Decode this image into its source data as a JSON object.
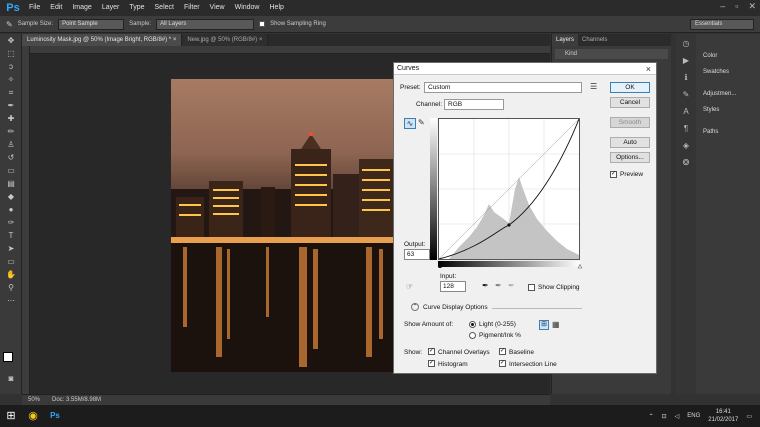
{
  "app": {
    "logo": "Ps"
  },
  "menu": [
    "File",
    "Edit",
    "Image",
    "Layer",
    "Type",
    "Select",
    "Filter",
    "View",
    "Window",
    "Help"
  ],
  "options": {
    "sample_size_label": "Sample Size:",
    "sample_size_value": "Point Sample",
    "sample_label": "Sample:",
    "sample_value": "All Layers",
    "ring_label": "Show Sampling Ring",
    "workspace": "Essentials"
  },
  "tabs": [
    {
      "label": "Luminosity Mask.jpg @ 50% (Image Bright, RGB/8#) *",
      "close": "×"
    },
    {
      "label": "New.jpg @ 50% (RGB/8#)",
      "close": "×"
    }
  ],
  "status": {
    "zoom": "50%",
    "doc": "Doc: 3.55M/8.98M"
  },
  "panels": {
    "tabs": [
      "Layers",
      "Channels"
    ],
    "search": "Kind"
  },
  "dock": [
    "Color",
    "Swatches",
    "Adjustmen...",
    "Styles",
    "Paths"
  ],
  "taskbar": {
    "lang": "ENG",
    "time": "16:41",
    "date": "21/02/2017"
  },
  "dialog": {
    "title": "Curves",
    "close": "×",
    "preset_label": "Preset:",
    "preset_value": "Custom",
    "channel_label": "Channel:",
    "channel_value": "RGB",
    "output_label": "Output:",
    "output_value": "63",
    "input_label": "Input:",
    "input_value": "128",
    "show_clipping": "Show Clipping",
    "display_options": "Curve Display Options",
    "show_amount_label": "Show Amount of:",
    "light_label": "Light  (0-255)",
    "pigment_label": "Pigment/Ink %",
    "show_label": "Show:",
    "channel_overlays": "Channel Overlays",
    "baseline": "Baseline",
    "histogram": "Histogram",
    "intersection": "Intersection Line",
    "buttons": {
      "ok": "OK",
      "cancel": "Cancel",
      "smooth": "Smooth",
      "auto": "Auto",
      "options": "Options...",
      "preview": "Preview"
    }
  }
}
